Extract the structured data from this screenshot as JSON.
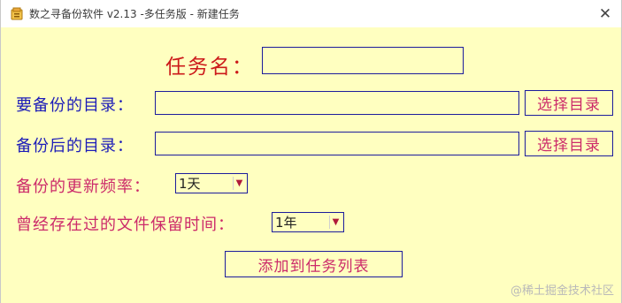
{
  "window": {
    "title": "数之寻备份软件 v2.13 -多任务版 - 新建任务",
    "close_glyph": "✕"
  },
  "form": {
    "task_name_label": "任务名：",
    "task_name_value": "",
    "backup_dir_label": "要备份的目录：",
    "backup_dir_value": "",
    "backup_dir_button": "选择目录",
    "dest_dir_label": "备份后的目录：",
    "dest_dir_value": "",
    "dest_dir_button": "选择目录",
    "frequency_label": "备份的更新频率：",
    "frequency_value": "1天",
    "retention_label": "曾经存在过的文件保留时间：",
    "retention_value": "1年",
    "submit_button": "添加到任务列表"
  },
  "watermark": "@稀土掘金技术社区",
  "colors": {
    "background": "#ffffc0",
    "label_red": "#cc1a1a",
    "label_blue": "#1c1cb8",
    "label_pink": "#cc2a6a",
    "border": "#1c1c9c"
  },
  "icons": {
    "app": "app-icon",
    "close": "close-icon",
    "dropdown": "chevron-down-icon"
  }
}
